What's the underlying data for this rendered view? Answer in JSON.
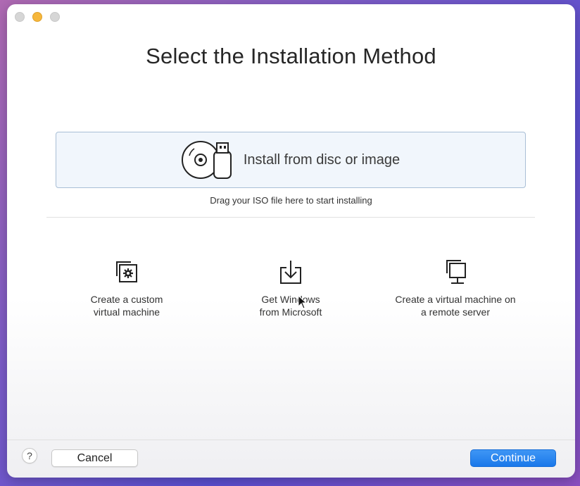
{
  "window": {
    "title": "Select the Installation Method"
  },
  "dropzone": {
    "label": "Install from disc or image",
    "hint": "Drag your ISO file here to start installing",
    "icon": "disc-usb-icon"
  },
  "options": [
    {
      "label_line1": "Create a custom",
      "label_line2": "virtual machine",
      "icon": "custom-vm-icon"
    },
    {
      "label_line1": "Get Windows",
      "label_line2": "from Microsoft",
      "icon": "download-icon"
    },
    {
      "label_line1": "Create a virtual machine on",
      "label_line2": "a remote server",
      "icon": "remote-server-icon"
    }
  ],
  "footer": {
    "help_label": "?",
    "cancel_label": "Cancel",
    "continue_label": "Continue"
  },
  "colors": {
    "accent": "#1a78ea",
    "dropzone_bg": "#f1f6fc",
    "dropzone_border": "#a9bfd6"
  }
}
